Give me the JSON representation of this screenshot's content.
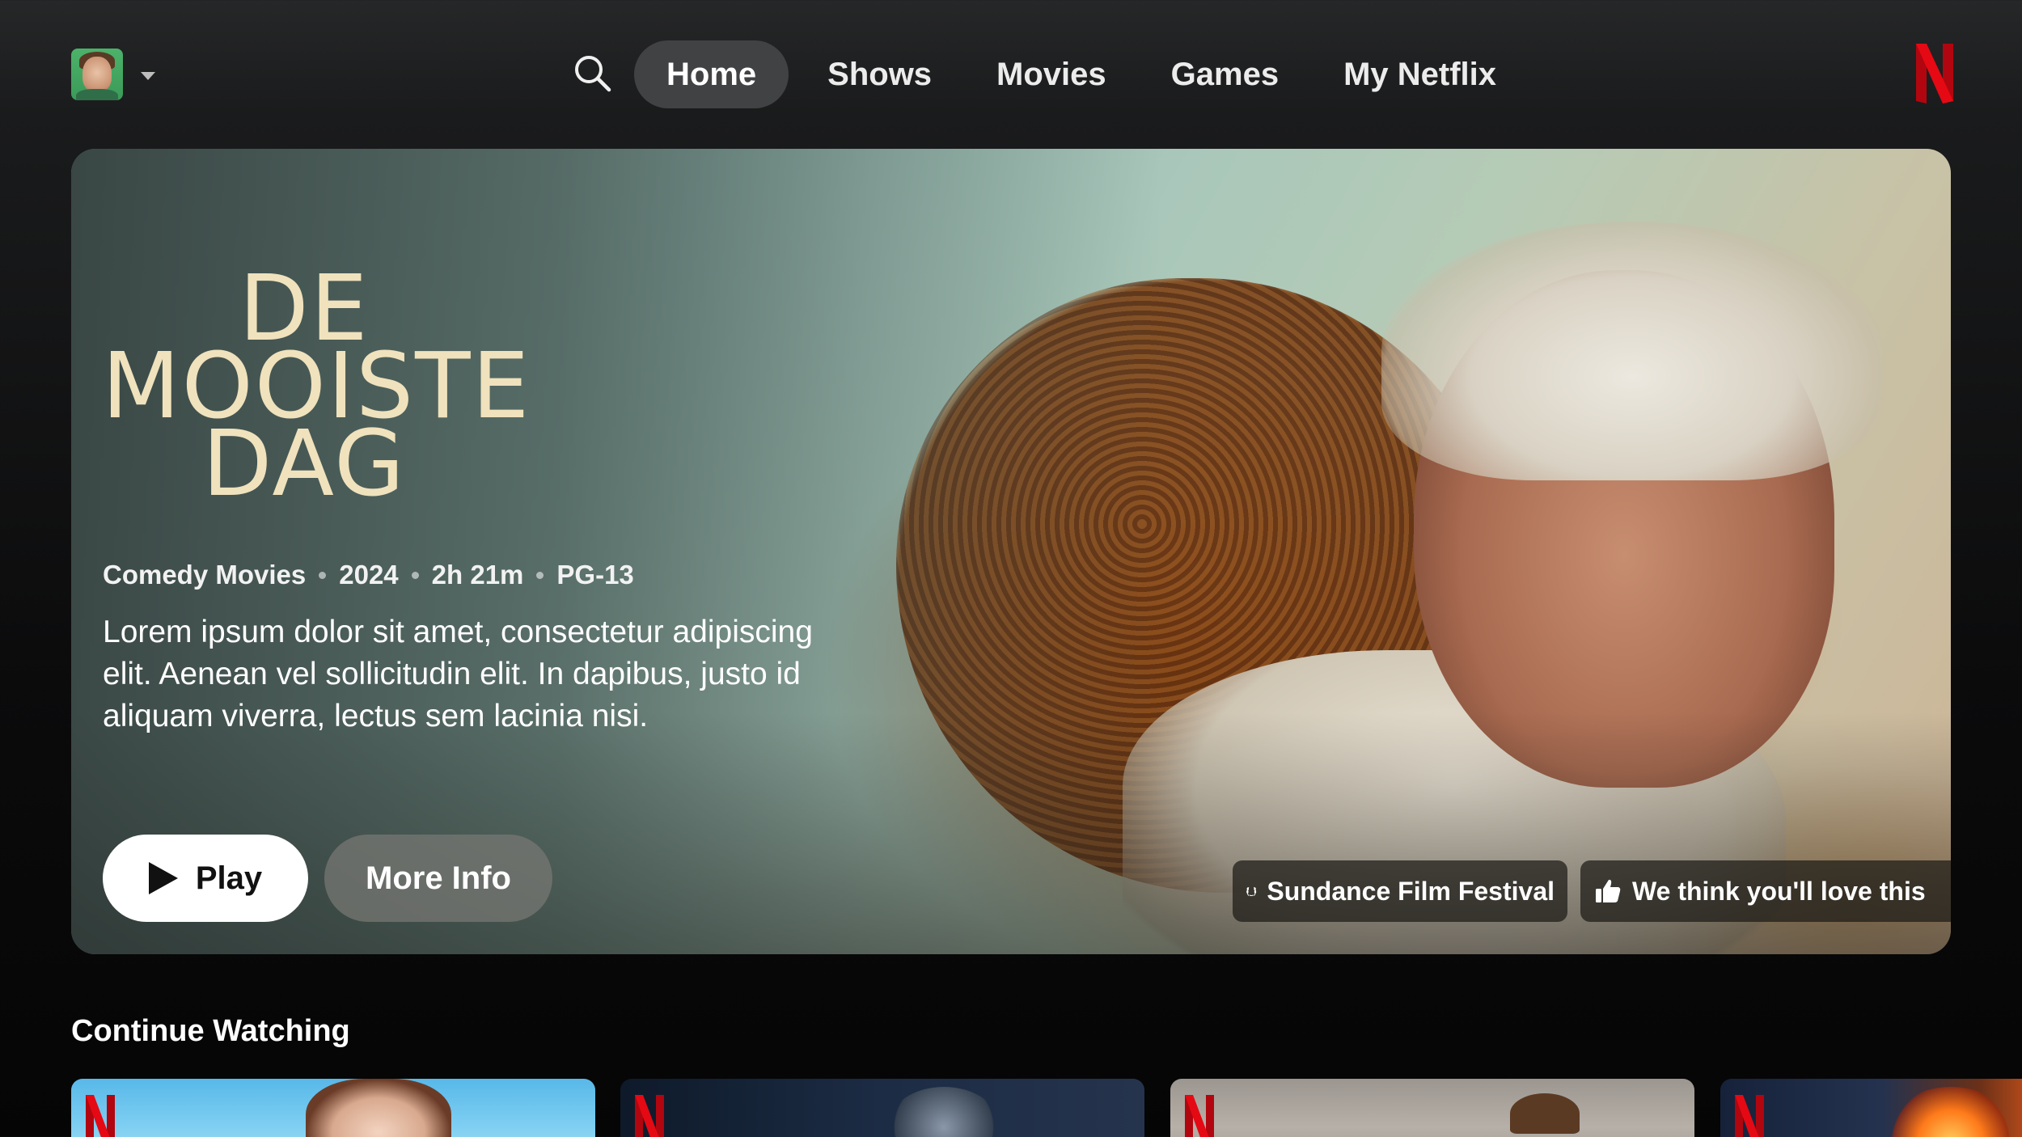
{
  "app": {
    "brand": "Netflix",
    "brand_color": "#E50914"
  },
  "header": {
    "profile": {
      "avatar": "profile-avatar",
      "menu_icon": "caret-down-icon"
    },
    "search_icon": "search-icon",
    "nav": [
      {
        "label": "Home",
        "active": true
      },
      {
        "label": "Shows",
        "active": false
      },
      {
        "label": "Movies",
        "active": false
      },
      {
        "label": "Games",
        "active": false
      },
      {
        "label": "My Netflix",
        "active": false
      }
    ]
  },
  "hero": {
    "title_lines": [
      "DE",
      "MOOISTE",
      "DAG"
    ],
    "genre": "Comedy Movies",
    "year": "2024",
    "duration": "2h 21m",
    "rating": "PG-13",
    "synopsis": "Lorem ipsum dolor sit amet, consectetur adipiscing elit. Aenean vel sollicitudin elit. In dapibus, justo id aliquam viverra, lectus sem lacinia nisi.",
    "play_label": "Play",
    "more_info_label": "More Info",
    "tags": [
      {
        "icon": "laurel-icon",
        "label": "Sundance Film Festival"
      },
      {
        "icon": "thumbs-up-icon",
        "label": "We think you'll love this"
      }
    ]
  },
  "rows": [
    {
      "title": "Continue Watching",
      "items": [
        {
          "badge": "netflix-n-logo"
        },
        {
          "badge": "netflix-n-logo"
        },
        {
          "badge": "netflix-n-logo"
        },
        {
          "badge": "netflix-n-logo"
        }
      ]
    }
  ]
}
